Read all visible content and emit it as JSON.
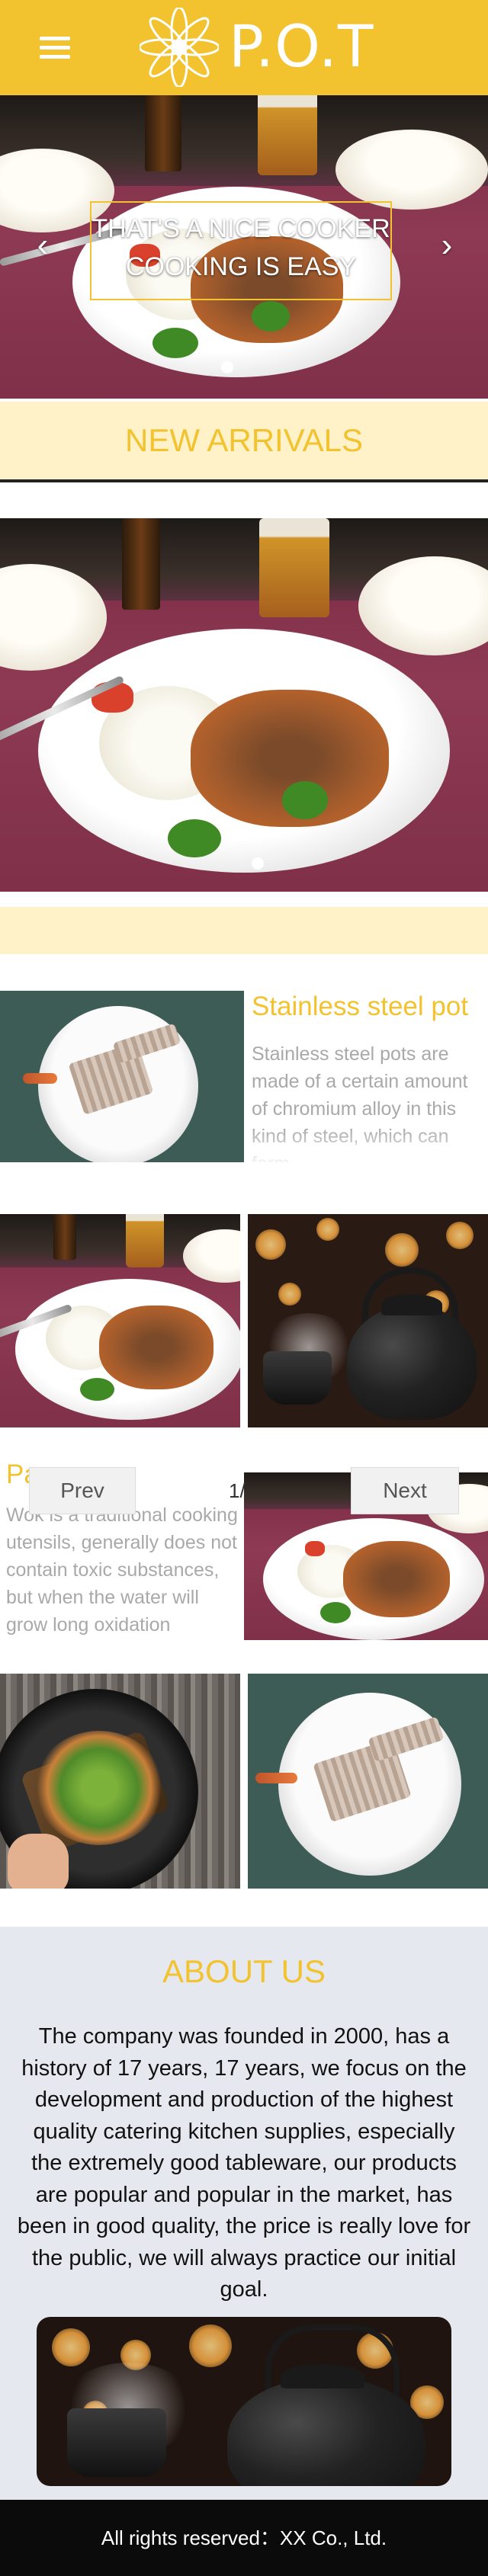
{
  "header": {
    "brand": "P.O.T",
    "menu_icon": "hamburger-menu-icon",
    "logo_icon": "flower-logo-icon",
    "bg_color": "#f3c22f"
  },
  "carousel": {
    "caption_line1": "THAT'S A NICE COOKER",
    "caption_line2": "COOKING IS EASY",
    "prev_arrow": "‹",
    "next_arrow": "›"
  },
  "new_arrivals": {
    "title": "NEW ARRIVALS"
  },
  "product": {
    "title": "Stainless steel pot",
    "description": "Stainless steel pots are made of a certain amount of chromium alloy in this kind of steel, which can form"
  },
  "product2": {
    "title": "Pa",
    "description": "Wok is a traditional cooking utensils, generally does not contain toxic substances, but when the water will grow long oxidation"
  },
  "pagination": {
    "prev_label": "Prev",
    "next_label": "Next",
    "indicator": "1/"
  },
  "about": {
    "title": "ABOUT US",
    "body": "The company was founded in 2000, has a history of 17 years, 17 years, we focus on the development and production of the highest quality catering kitchen supplies, especially the extremely good tableware, our products are popular and popular in the market, has been in good quality, the price is really love for the public, we will always practice our initial goal."
  },
  "footer": {
    "text": "All rights reserved：XX Co., Ltd."
  },
  "colors": {
    "accent": "#f3c22f",
    "band": "#fff2c9",
    "about_bg": "#e5e8ee",
    "footer_bg": "#0b0b0b"
  }
}
